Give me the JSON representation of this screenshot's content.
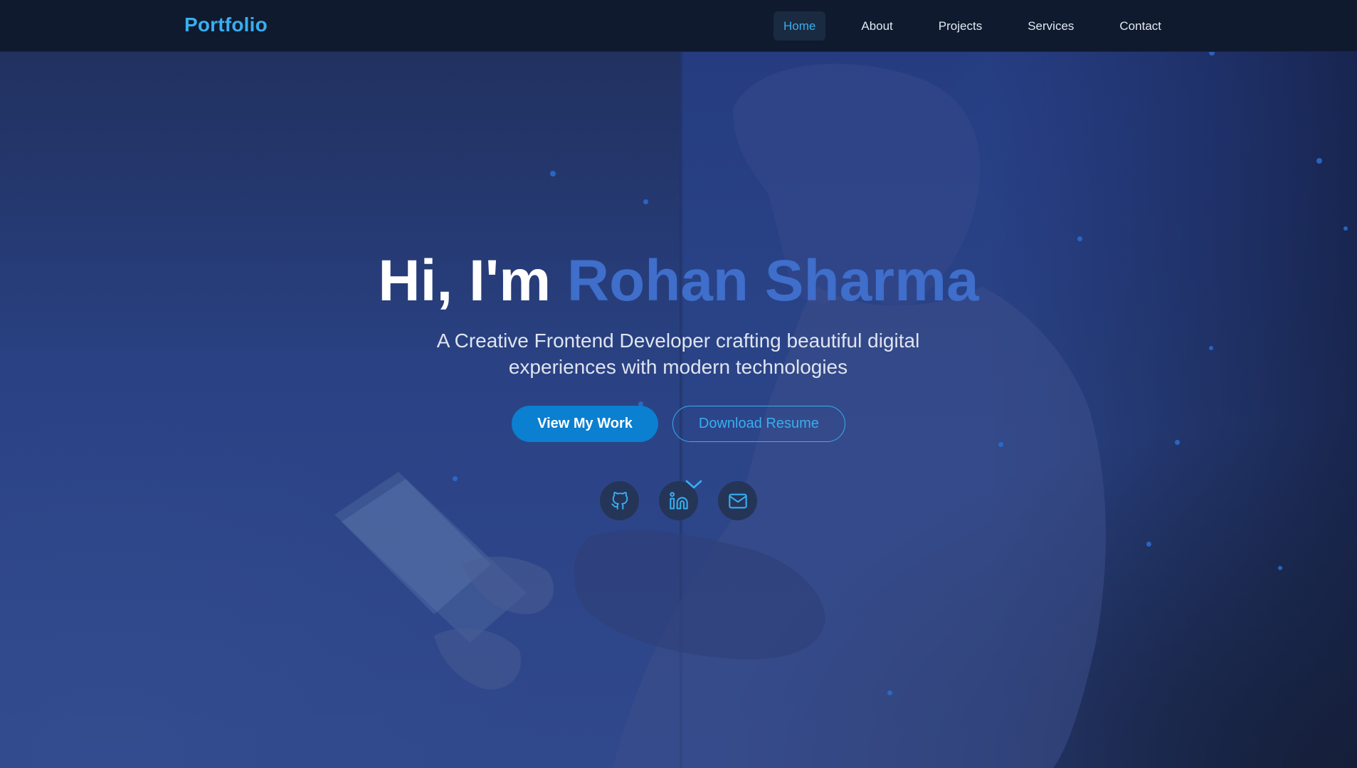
{
  "header": {
    "logo": "Portfolio",
    "nav": [
      {
        "label": "Home",
        "active": true
      },
      {
        "label": "About"
      },
      {
        "label": "Projects"
      },
      {
        "label": "Services"
      },
      {
        "label": "Contact"
      }
    ]
  },
  "hero": {
    "greeting": "Hi, I'm ",
    "name": "Rohan Sharma",
    "subtitle": "A Creative Frontend Developer crafting beautiful digital experiences with modern technologies",
    "primary_button": "View My Work",
    "secondary_button": "Download Resume",
    "social": [
      {
        "icon": "github-icon"
      },
      {
        "icon": "linkedin-icon"
      },
      {
        "icon": "mail-icon"
      }
    ]
  },
  "colors": {
    "accent": "#38aef0",
    "primary_button_bg": "#0b7fd0",
    "name_highlight": "#3f6ecb",
    "navbar_bg": "#0f1a2e"
  }
}
